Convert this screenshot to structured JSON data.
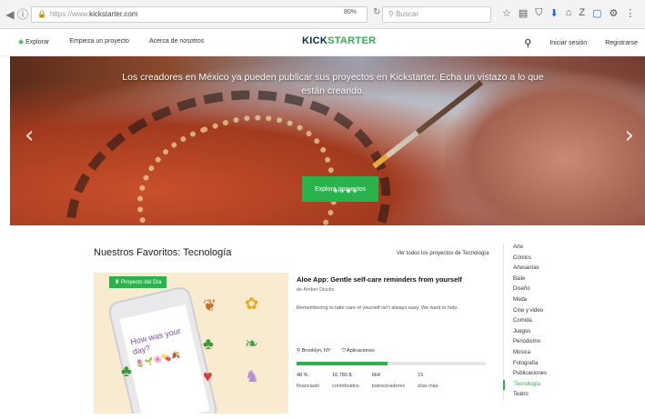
{
  "browser": {
    "back": "◀",
    "url_scheme": "https://www.",
    "url_domain": "kickstarter.com",
    "zoom": "80%",
    "search_placeholder": "Buscar"
  },
  "header": {
    "explore": "Explorar",
    "start_project": "Empieza un proyecto",
    "about": "Acerca de nosotros",
    "logo_a": "KICK",
    "logo_b": "STARTER",
    "login": "Iniciar sesión",
    "register": "Registrarse"
  },
  "hero": {
    "text": "Los creadores en México ya pueden publicar sus proyectos en Kickstarter. Echa un vistazo a lo que están creando.",
    "button": "Explora proyectos",
    "slide_count": 4,
    "active_slide": 2
  },
  "favorites": {
    "title": "Nuestros Favoritos: Tecnología",
    "see_all": "Ver todos los proyectos de Tecnología",
    "badge": "Proyecto del Día",
    "phone_text": "How was your day?",
    "project": {
      "title": "Aloe App: Gentle self-care reminders from yourself",
      "author": "de Amber Discko",
      "description": "Remembering to take care of yourself isn't always easy. We want to help.",
      "location": "Brooklyn, NY",
      "category": "Aplicaciones",
      "funded_fraction": 0.48,
      "stats": [
        {
          "value": "48 %",
          "label": "financiado"
        },
        {
          "value": "16 780 $",
          "label": "contribuidos"
        },
        {
          "value": "664",
          "label": "patrocinadores"
        },
        {
          "value": "15",
          "label": "días más"
        }
      ]
    }
  },
  "categories": [
    "Arte",
    "Cómics",
    "Artesanías",
    "Baile",
    "Diseño",
    "Moda",
    "Cine y video",
    "Comida",
    "Juegos",
    "Periodismo",
    "Música",
    "Fotografía",
    "Publicaciones",
    "Tecnología",
    "Teatro"
  ],
  "active_category": "Tecnología",
  "colors": {
    "brand_green": "#2bb24c",
    "logo_dark": "#0f2c3a"
  }
}
